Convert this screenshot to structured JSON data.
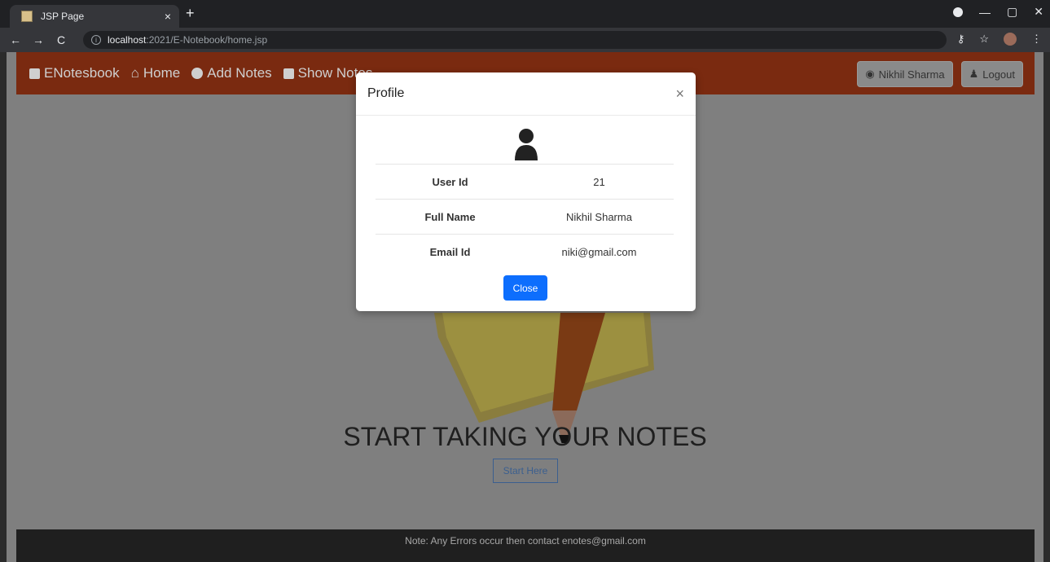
{
  "browser": {
    "tab_title": "JSP Page",
    "tab_close": "×",
    "new_tab": "+",
    "url_host": "localhost",
    "url_path": ":2021/E-Notebook/home.jsp"
  },
  "navbar": {
    "brand": "ENotesbook",
    "items": [
      {
        "label": "Home"
      },
      {
        "label": "Add Notes"
      },
      {
        "label": "Show Notes"
      }
    ],
    "user_button": "Nikhil Sharma",
    "logout_button": "Logout"
  },
  "hero": {
    "title": "START TAKING YOUR NOTES",
    "start_button": "Start Here"
  },
  "footer": {
    "text": "Note: Any Errors occur then contact enotes@gmail.com"
  },
  "modal": {
    "title": "Profile",
    "close_x": "×",
    "rows": [
      {
        "label": "User Id",
        "value": "21"
      },
      {
        "label": "Full Name",
        "value": "Nikhil Sharma"
      },
      {
        "label": "Email Id",
        "value": "niki@gmail.com"
      }
    ],
    "close_button": "Close"
  },
  "colors": {
    "navbar": "#7a2a10",
    "primary_button": "#0d6efd",
    "footer": "#1f1f1f"
  }
}
